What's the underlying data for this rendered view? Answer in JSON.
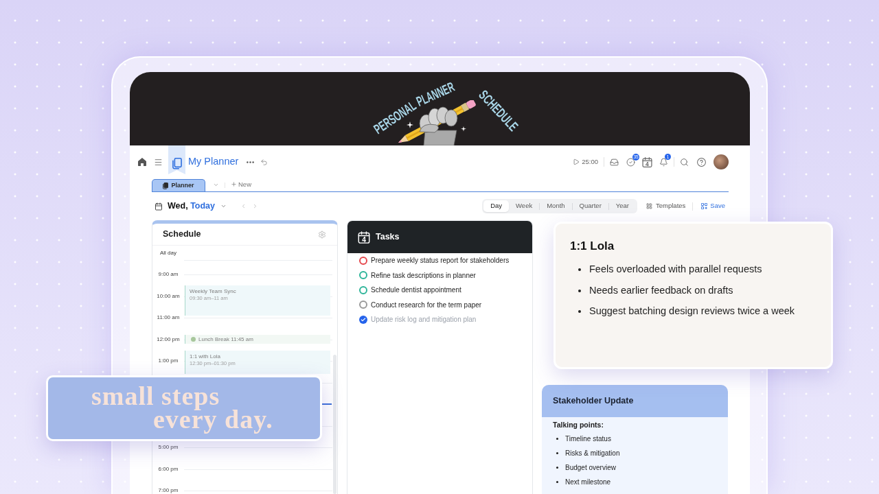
{
  "banner": {
    "title_words": [
      "PERSONAL",
      "PLANNER"
    ],
    "subtitle": "SCHEDULE"
  },
  "toolbar": {
    "title": "My Planner",
    "timer": "25:00",
    "tasks_badge": "35",
    "calendar_day": "4",
    "notifications_badge": "1"
  },
  "tabs": [
    {
      "label": "Planner",
      "selected": true
    }
  ],
  "new_tab": "New",
  "date_bar": {
    "day": "Wed,",
    "today": "Today",
    "views": [
      {
        "label": "Day",
        "selected": true
      },
      {
        "label": "Week",
        "selected": false
      },
      {
        "label": "Month",
        "selected": false
      },
      {
        "label": "Quarter",
        "selected": false
      },
      {
        "label": "Year",
        "selected": false
      }
    ],
    "templates": "Templates",
    "save": "Save"
  },
  "schedule": {
    "title": "Schedule",
    "all_day": "All day",
    "hours_top": [
      "9:00 am",
      "10:00 am",
      "11:00 am",
      "12:00 pm",
      "1:00 pm"
    ],
    "hours_bottom": [
      "5:00 pm",
      "6:00 pm",
      "7:00 pm"
    ],
    "events": [
      {
        "kind": "block",
        "title": "Weekly Team Sync",
        "time": "09:30 am–11 am"
      },
      {
        "kind": "marker",
        "title": "Lunch Break 11:45 am",
        "color": "#a8c79c"
      },
      {
        "kind": "block",
        "title": "1:1 with Lola",
        "time": "12:30 pm–01:30 pm"
      }
    ]
  },
  "tasks": {
    "title": "Tasks",
    "day": "4",
    "items": [
      {
        "label": "Prepare weekly status report for stakeholders",
        "checked": false,
        "color": "#e5484d"
      },
      {
        "label": "Refine task descriptions in planner",
        "checked": false,
        "color": "#2fb59a"
      },
      {
        "label": "Schedule dentist appointment",
        "checked": false,
        "color": "#2fb59a"
      },
      {
        "label": "Conduct research for the term paper",
        "checked": false,
        "color": "#9a9a9a"
      },
      {
        "label": "Update risk log and mitigation plan",
        "checked": true,
        "color": "#2563eb"
      }
    ]
  },
  "one_on_one": {
    "title": "1:1 Lola",
    "points": [
      "Feels overloaded with parallel requests",
      "Needs earlier feedback on drafts",
      "Suggest batching design reviews twice a week"
    ]
  },
  "stakeholder_update": {
    "title": "Stakeholder Update",
    "subtitle": "Talking points:",
    "points": [
      "Timeline status",
      "Risks & mitigation",
      "Budget overview",
      "Next milestone"
    ]
  },
  "motto": {
    "lines": [
      "small steps",
      "every day."
    ]
  }
}
